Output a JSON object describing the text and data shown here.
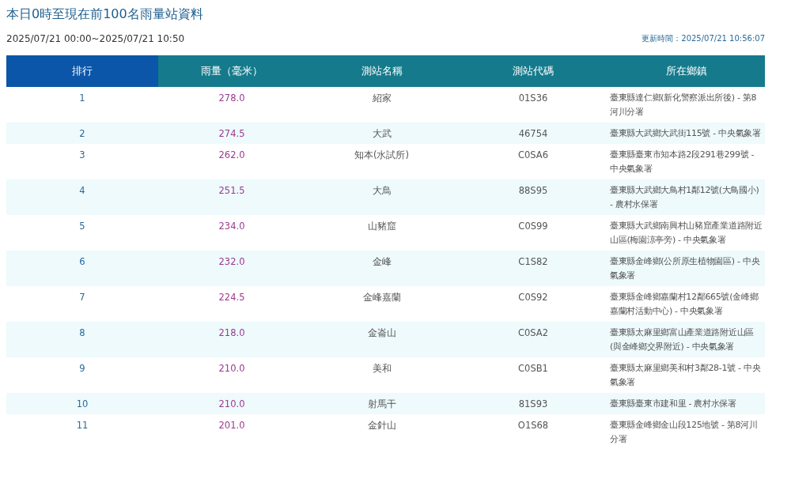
{
  "title": "本日0時至現在前100名雨量站資料",
  "period": "2025/07/21 00:00~2025/07/21 10:50",
  "updated": "更新時間：2025/07/21 10:56:07",
  "table": {
    "columns": [
      {
        "label": "排行",
        "selected": true
      },
      {
        "label": "雨量（毫米）",
        "selected": false
      },
      {
        "label": "測站名稱",
        "selected": false
      },
      {
        "label": "測站代碼",
        "selected": false
      },
      {
        "label": "所在鄉鎮",
        "selected": false
      }
    ],
    "rows": [
      [
        "1",
        "278.0",
        "紹家",
        "01S36",
        "臺東縣達仁鄉(新化警察派出所後) - 第8河川分署"
      ],
      [
        "2",
        "274.5",
        "大武",
        "46754",
        "臺東縣大武鄉大武街115號 - 中央氣象署"
      ],
      [
        "3",
        "262.0",
        "知本(水試所)",
        "C0SA6",
        "臺東縣臺東市知本路2段291巷299號 - 中央氣象署"
      ],
      [
        "4",
        "251.5",
        "大鳥",
        "88S95",
        "臺東縣大武鄉大鳥村1鄰12號(大鳥國小) - 農村水保署"
      ],
      [
        "5",
        "234.0",
        "山豬窟",
        "C0S99",
        "臺東縣大武鄉南興村山豬窟產業道路附近山區(梅園涼亭旁) - 中央氣象署"
      ],
      [
        "6",
        "232.0",
        "金峰",
        "C1S82",
        "臺東縣金峰鄉(公所原生植物園區) - 中央氣象署"
      ],
      [
        "7",
        "224.5",
        "金峰嘉蘭",
        "C0S92",
        "臺東縣金峰鄉嘉蘭村12鄰665號(金峰鄉嘉蘭村活動中心) - 中央氣象署"
      ],
      [
        "8",
        "218.0",
        "金崙山",
        "C0SA2",
        "臺東縣太麻里鄉富山產業道路附近山區(與金峰鄉交界附近) - 中央氣象署"
      ],
      [
        "9",
        "210.0",
        "美和",
        "C0SB1",
        "臺東縣太麻里鄉美和村3鄰28-1號 - 中央氣象署"
      ],
      [
        "10",
        "210.0",
        "射馬干",
        "81S93",
        "臺東縣臺東市建和里 - 農村水保署"
      ],
      [
        "11",
        "201.0",
        "金針山",
        "O1S68",
        "臺東縣金峰鄉金山段125地號 - 第8河川分署"
      ]
    ]
  }
}
